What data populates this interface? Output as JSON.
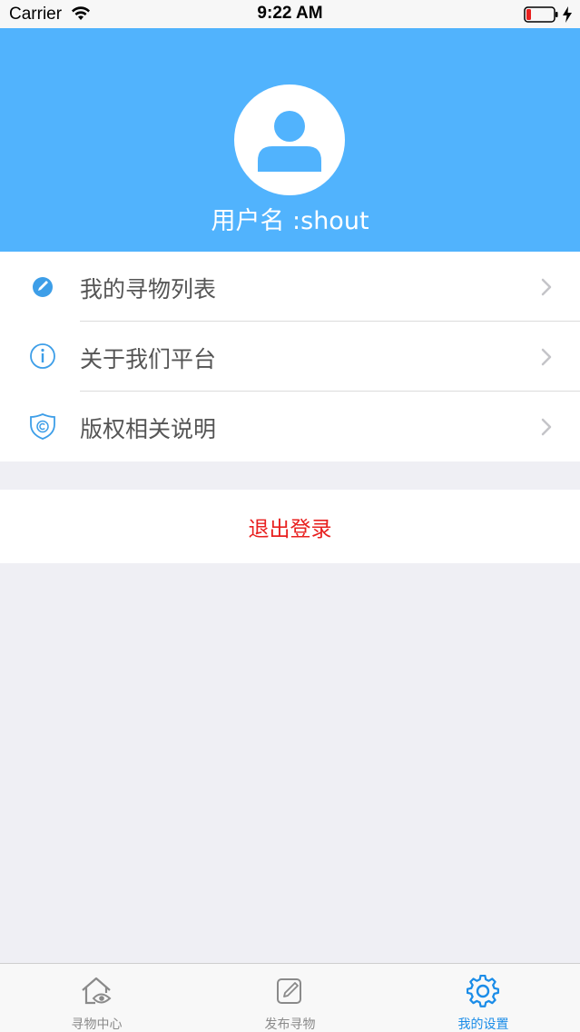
{
  "status_bar": {
    "carrier": "Carrier",
    "time": "9:22 AM"
  },
  "profile": {
    "username": "用户名 :shout",
    "header_color": "#51b3fd"
  },
  "menu": {
    "items": [
      {
        "label": "我的寻物列表",
        "icon": "pencil-circle-icon"
      },
      {
        "label": "关于我们平台",
        "icon": "info-circle-icon"
      },
      {
        "label": "版权相关说明",
        "icon": "copyright-shield-icon"
      }
    ]
  },
  "logout": {
    "label": "退出登录",
    "color": "#e8201f"
  },
  "tab_bar": {
    "tabs": [
      {
        "label": "寻物中心",
        "icon": "home-eye-icon",
        "active": false
      },
      {
        "label": "发布寻物",
        "icon": "edit-icon",
        "active": false
      },
      {
        "label": "我的设置",
        "icon": "gear-icon",
        "active": true
      }
    ],
    "active_color": "#1a8ce8"
  }
}
